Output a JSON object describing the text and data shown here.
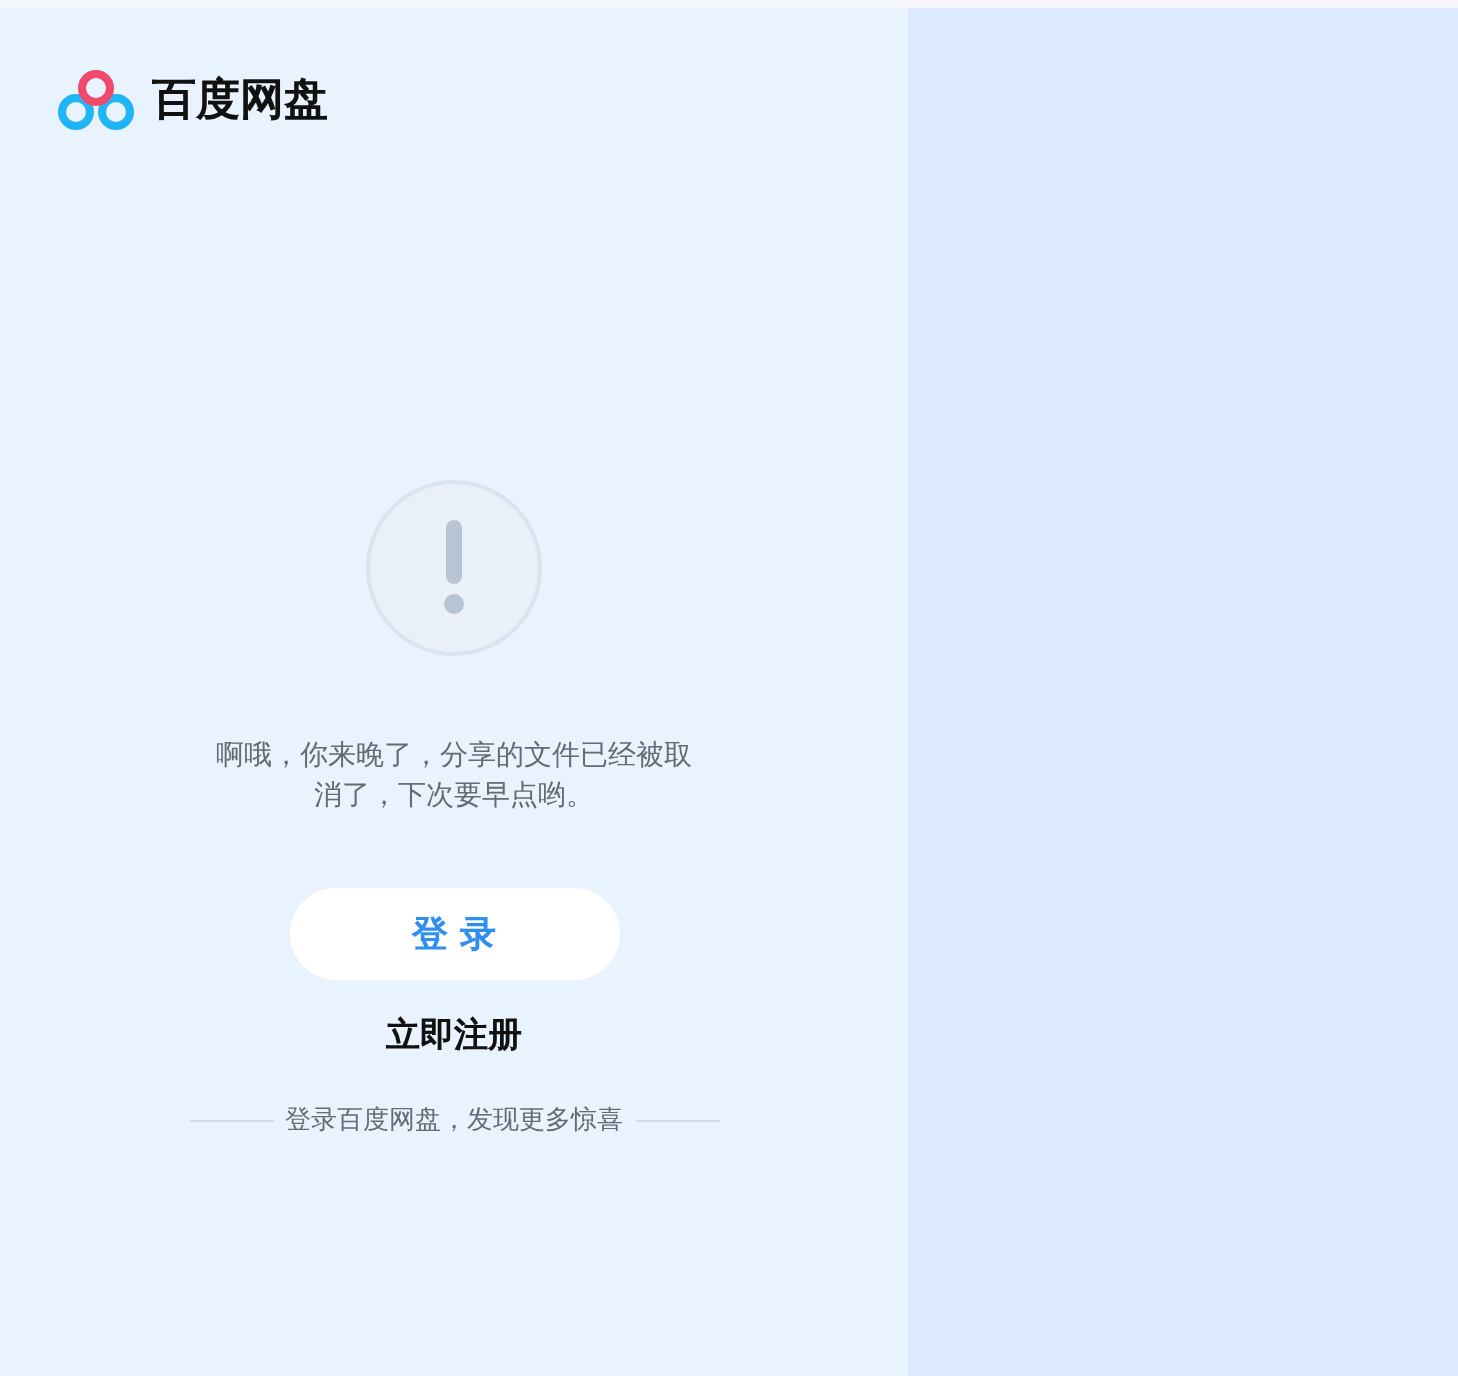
{
  "logo": {
    "text": "百度网盘"
  },
  "message": "啊哦，你来晚了，分享的文件已经被取消了，下次要早点哟。",
  "login_button": "登 录",
  "register_link": "立即注册",
  "footer_tagline": "登录百度网盘，发现更多惊喜"
}
